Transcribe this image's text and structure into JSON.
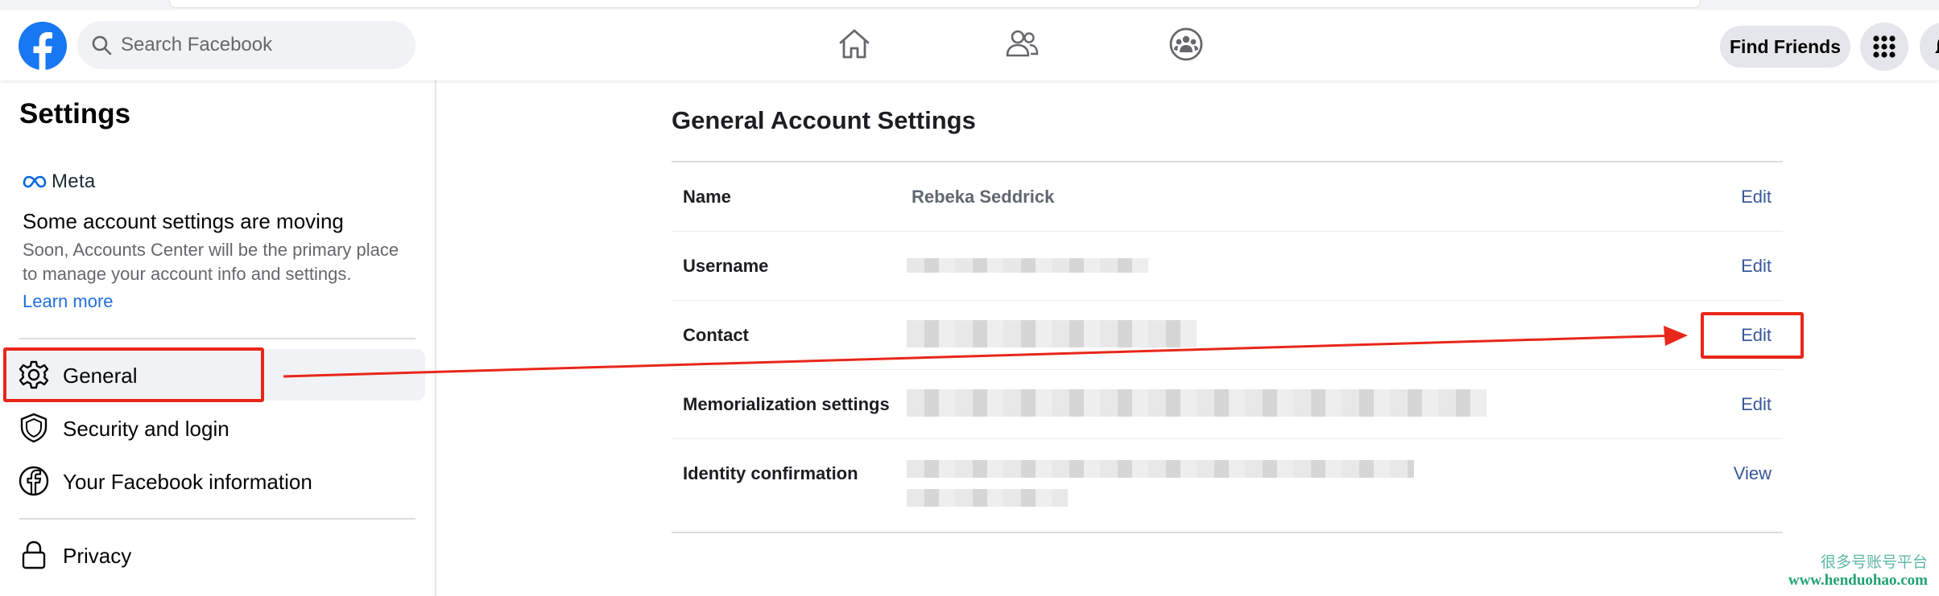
{
  "header": {
    "search_placeholder": "Search Facebook",
    "find_friends_label": "Find Friends",
    "icons": [
      "facebook-logo-icon",
      "search-icon",
      "home-icon",
      "friends-icon",
      "groups-icon",
      "menu-grid-icon",
      "notifications-icon"
    ]
  },
  "sidebar": {
    "title": "Settings",
    "meta_label": "Meta",
    "notice_title": "Some account settings are moving",
    "notice_desc": "Soon, Accounts Center will be the primary place to manage your account info and settings.",
    "learn_more": "Learn more",
    "items": [
      {
        "label": "General",
        "icon": "gear-icon",
        "active": true
      },
      {
        "label": "Security and login",
        "icon": "shield-icon",
        "active": false
      },
      {
        "label": "Your Facebook information",
        "icon": "facebook-icon",
        "active": false
      },
      {
        "label": "Privacy",
        "icon": "lock-icon",
        "active": false
      }
    ]
  },
  "main": {
    "title": "General Account Settings",
    "rows": [
      {
        "label": "Name",
        "value": "Rebeka Seddrick",
        "action": "Edit"
      },
      {
        "label": "Username",
        "value": "",
        "action": "Edit"
      },
      {
        "label": "Contact",
        "value": "",
        "action": "Edit"
      },
      {
        "label": "Memorialization settings",
        "value": "",
        "action": "Edit"
      },
      {
        "label": "Identity confirmation",
        "value": "",
        "action": "View"
      }
    ]
  },
  "watermark": {
    "cn": "很多号账号平台",
    "url": "www.henduohao.com"
  },
  "colors": {
    "facebook_blue": "#1877f2",
    "link_blue": "#385898",
    "annotation_red": "#e8261a"
  }
}
